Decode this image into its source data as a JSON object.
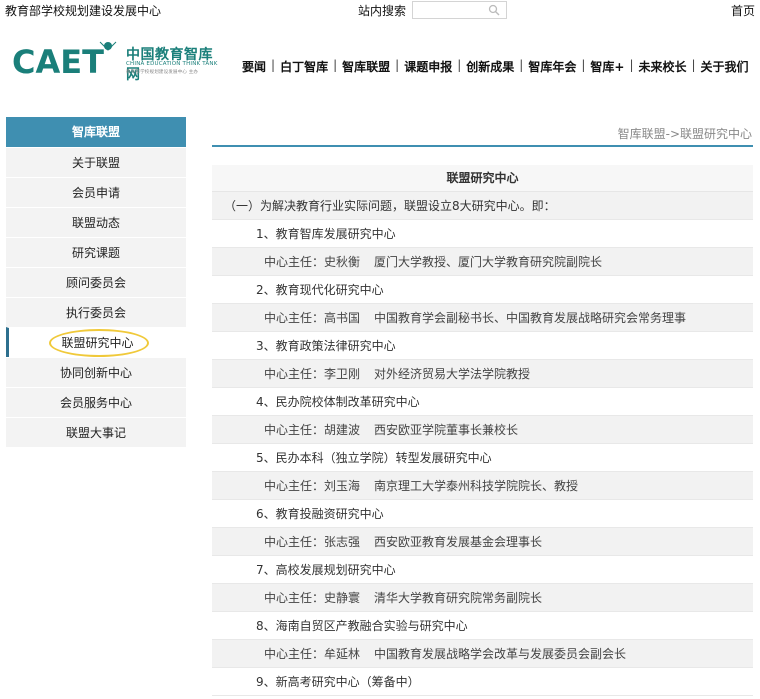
{
  "topbar": {
    "org_name": "教育部学校规划建设发展中心",
    "search_label": "站内搜索",
    "search_placeholder": "",
    "home_label": "首页"
  },
  "logo": {
    "letters": "CAET",
    "cn_name": "中国教育智库网",
    "en_name": "CHINA EDUCATION THINK TANK",
    "sub_name": "教育部学校规划建设发展中心 主办"
  },
  "nav": {
    "items": [
      "要闻",
      "白丁智库",
      "智库联盟",
      "课题申报",
      "创新成果",
      "智库年会",
      "智库+",
      "未来校长",
      "关于我们"
    ]
  },
  "sidebar": {
    "title": "智库联盟",
    "items": [
      "关于联盟",
      "会员申请",
      "联盟动态",
      "研究课题",
      "顾问委员会",
      "执行委员会",
      "联盟研究中心",
      "协同创新中心",
      "会员服务中心",
      "联盟大事记"
    ],
    "active_index": 6
  },
  "breadcrumb": "智库联盟->联盟研究中心",
  "content": {
    "title": "联盟研究中心",
    "intro": "（一）为解决教育行业实际问题，联盟设立8大研究中心。即：",
    "centers": [
      {
        "name": "1、教育智库发展研究中心",
        "director": "中心主任：史秋衡",
        "title": "厦门大学教授、厦门大学教育研究院副院长"
      },
      {
        "name": "2、教育现代化研究中心",
        "director": "中心主任：高书国",
        "title": "中国教育学会副秘书长、中国教育发展战略研究会常务理事"
      },
      {
        "name": "3、教育政策法律研究中心",
        "director": "中心主任：李卫刚",
        "title": "对外经济贸易大学法学院教授"
      },
      {
        "name": "4、民办院校体制改革研究中心",
        "director": "中心主任：胡建波",
        "title": "西安欧亚学院董事长兼校长"
      },
      {
        "name": "5、民办本科（独立学院）转型发展研究中心",
        "director": "中心主任：刘玉海",
        "title": "南京理工大学泰州科技学院院长、教授"
      },
      {
        "name": "6、教育投融资研究中心",
        "director": "中心主任：张志强",
        "title": "西安欧亚教育发展基金会理事长"
      },
      {
        "name": "7、高校发展规划研究中心",
        "director": "中心主任：史静寰",
        "title": "清华大学教育研究院常务副院长"
      },
      {
        "name": "8、海南自贸区产教融合实验与研究中心",
        "director": "中心主任：牟延林",
        "title": "中国教育发展战略学会改革与发展委员会副会长"
      }
    ],
    "last_item": "9、新高考研究中心（筹备中）"
  },
  "colors": {
    "brand_teal": "#1a7f7a",
    "sidebar_header": "#3f8fb1",
    "highlight_circle": "#f0c93a"
  }
}
